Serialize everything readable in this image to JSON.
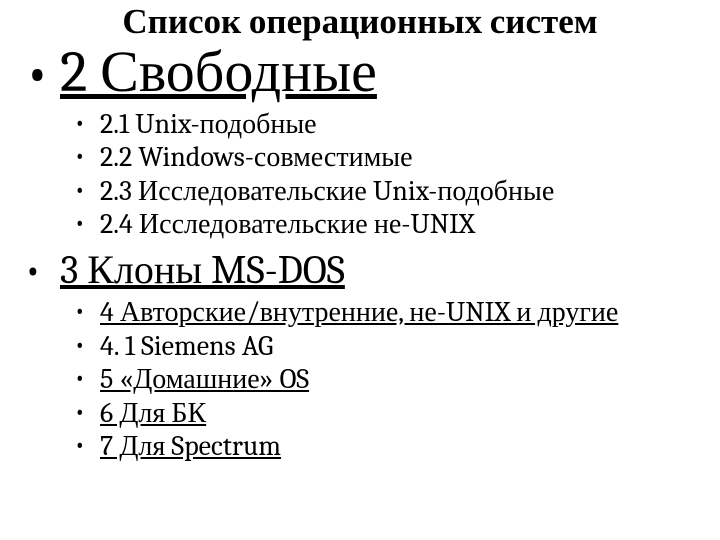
{
  "title": "Список операционных систем",
  "section1": {
    "label": "2 Свободные",
    "items": [
      {
        "text": "2.1 Unix-подобные",
        "underline": false
      },
      {
        "text": "2.2 Windows-совместимые",
        "underline": false
      },
      {
        "text": "2.3 Исследовательские Unix-подобные",
        "underline": false
      },
      {
        "text": "2.4 Исследовательские не-UNIX",
        "underline": false
      }
    ]
  },
  "section2": {
    "label": "3 Клоны MS-DOS",
    "items": [
      {
        "text": "4 Авторские/внутренние, не-UNIX и другие",
        "underline": true
      },
      {
        "text": "4. 1 Siemens AG",
        "underline": false
      },
      {
        "text": "5 «Домашние» OS",
        "underline": true
      },
      {
        "text": "6 Для БК",
        "underline": true
      },
      {
        "text": "7 Для Spectrum",
        "underline": true
      }
    ]
  }
}
